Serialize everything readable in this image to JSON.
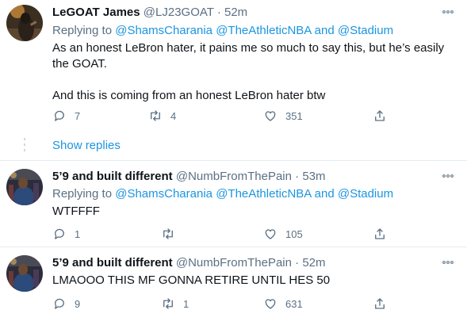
{
  "tweets": [
    {
      "name": "LeGOAT James",
      "handle": "@LJ23GOAT",
      "dot": "·",
      "time": "52m",
      "replying_prefix": "Replying to",
      "mentions": [
        "@ShamsCharania",
        "@TheAthleticNBA",
        "@Stadium"
      ],
      "and": "and",
      "text": [
        "As an honest LeBron hater, it pains me so much to say this, but he’s easily the GOAT.",
        "And this is coming from an honest LeBron hater btw"
      ],
      "reply_count": "7",
      "retweet_count": "4",
      "like_count": "351",
      "more_icon": "more-dots-icon"
    },
    {
      "name": "5’9 and built different",
      "handle": "@NumbFromThePain",
      "dot": "·",
      "time": "53m",
      "replying_prefix": "Replying to",
      "mentions": [
        "@ShamsCharania",
        "@TheAthleticNBA",
        "@Stadium"
      ],
      "and": "and",
      "text": [
        "WTFFFF"
      ],
      "reply_count": "1",
      "retweet_count": "",
      "like_count": "105",
      "more_icon": "more-dots-icon"
    },
    {
      "name": "5’9 and built different",
      "handle": "@NumbFromThePain",
      "dot": "·",
      "time": "52m",
      "text": [
        "LMAOOO THIS MF GONNA RETIRE UNTIL HES 50"
      ],
      "reply_count": "9",
      "retweet_count": "1",
      "like_count": "631",
      "more_icon": "more-dots-icon"
    }
  ],
  "show_replies": "Show replies",
  "colors": {
    "link": "#1b95e0",
    "muted": "#5b7083",
    "text": "#0f1419",
    "divider": "#e6ecf0"
  }
}
